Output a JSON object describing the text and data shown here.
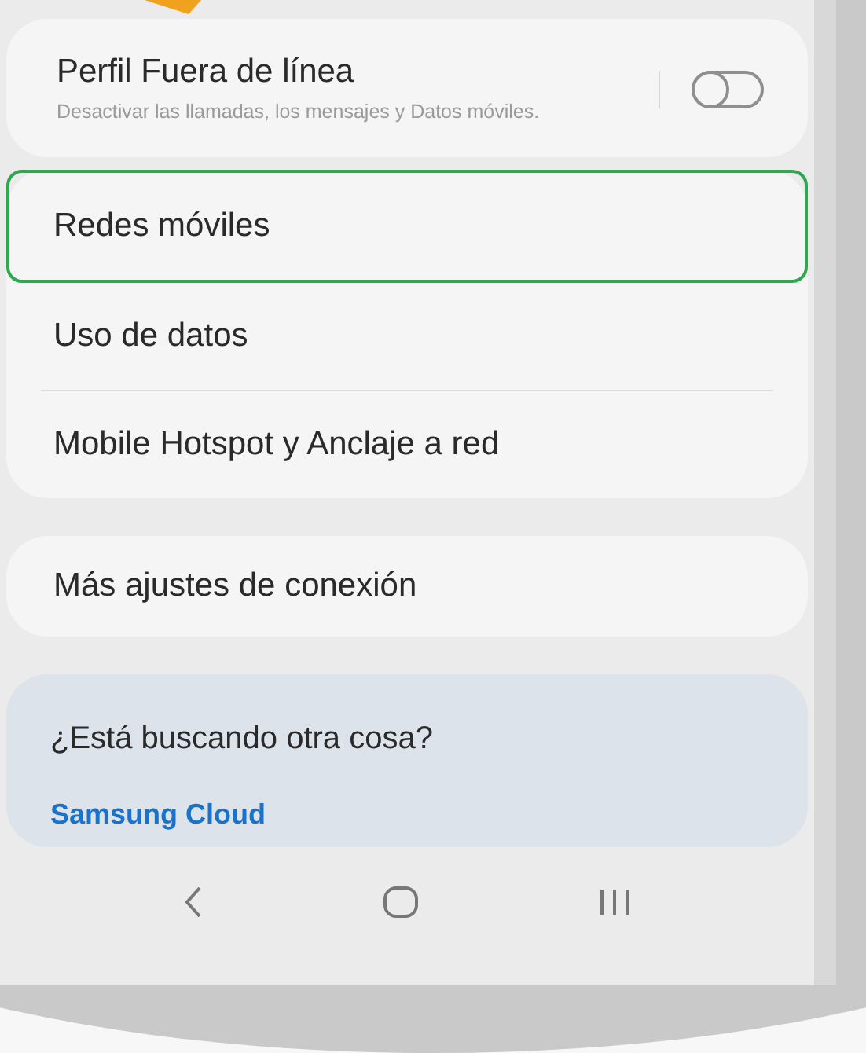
{
  "offline_card": {
    "title": "Perfil Fuera de línea",
    "subtitle": "Desactivar las llamadas, los mensajes y Datos móviles.",
    "on": false
  },
  "network_items": [
    {
      "label": "Redes móviles",
      "highlighted": true
    },
    {
      "label": "Uso de datos",
      "highlighted": false
    },
    {
      "label": "Mobile Hotspot y Anclaje a red",
      "highlighted": false
    }
  ],
  "more_settings": {
    "label": "Más ajustes de conexión"
  },
  "suggestions": {
    "title": "¿Está buscando otra cosa?",
    "links": [
      "Samsung Cloud"
    ]
  }
}
